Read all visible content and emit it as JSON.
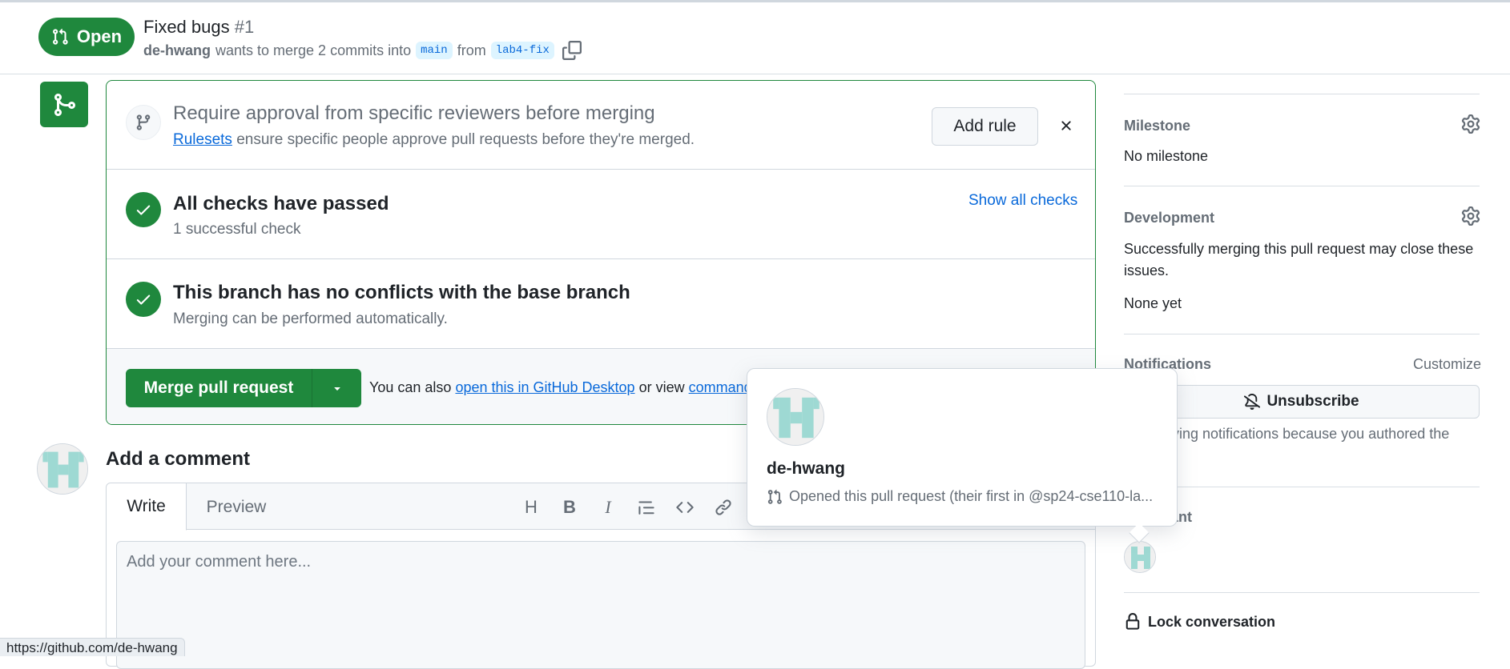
{
  "header": {
    "state_label": "Open",
    "title": "Fixed bugs",
    "number": "#1",
    "author": "de-hwang",
    "merge_text": "wants to merge 2 commits into",
    "base_branch": "main",
    "from_text": "from",
    "head_branch": "lab4-fix"
  },
  "mergebox": {
    "ruleset": {
      "title": "Require approval from specific reviewers before merging",
      "link": "Rulesets",
      "desc": "ensure specific people approve pull requests before they're merged.",
      "button": "Add rule"
    },
    "checks": {
      "title": "All checks have passed",
      "desc": "1 successful check",
      "link": "Show all checks"
    },
    "conflicts": {
      "title": "This branch has no conflicts with the base branch",
      "desc": "Merging can be performed automatically."
    },
    "merge": {
      "button": "Merge pull request",
      "also_text": "You can also",
      "desktop_link": "open this in GitHub Desktop",
      "or_view": "or view",
      "cmd_link": "command"
    }
  },
  "comment": {
    "heading": "Add a comment",
    "tab_write": "Write",
    "tab_preview": "Preview",
    "toolbar": {
      "heading": "H",
      "bold": "B",
      "italic": "I"
    },
    "placeholder": "Add your comment here..."
  },
  "sidebar": {
    "milestone_head": "Milestone",
    "milestone_value": "No milestone",
    "development_head": "Development",
    "development_text": "Successfully merging this pull request may close these issues.",
    "development_value": "None yet",
    "notifications_head": "Notifications",
    "customize": "Customize",
    "unsubscribe": "Unsubscribe",
    "notif_text": "ceiving notifications because you authored the",
    "participants_head": "pant",
    "lock": "Lock conversation"
  },
  "hovercard": {
    "name": "de-hwang",
    "note": "Opened this pull request (their first in @sp24-cse110-la..."
  },
  "statusbar": {
    "url": "https://github.com/de-hwang"
  },
  "colors": {
    "green": "#1f883d",
    "link": "#0969da",
    "muted": "#656d76"
  }
}
